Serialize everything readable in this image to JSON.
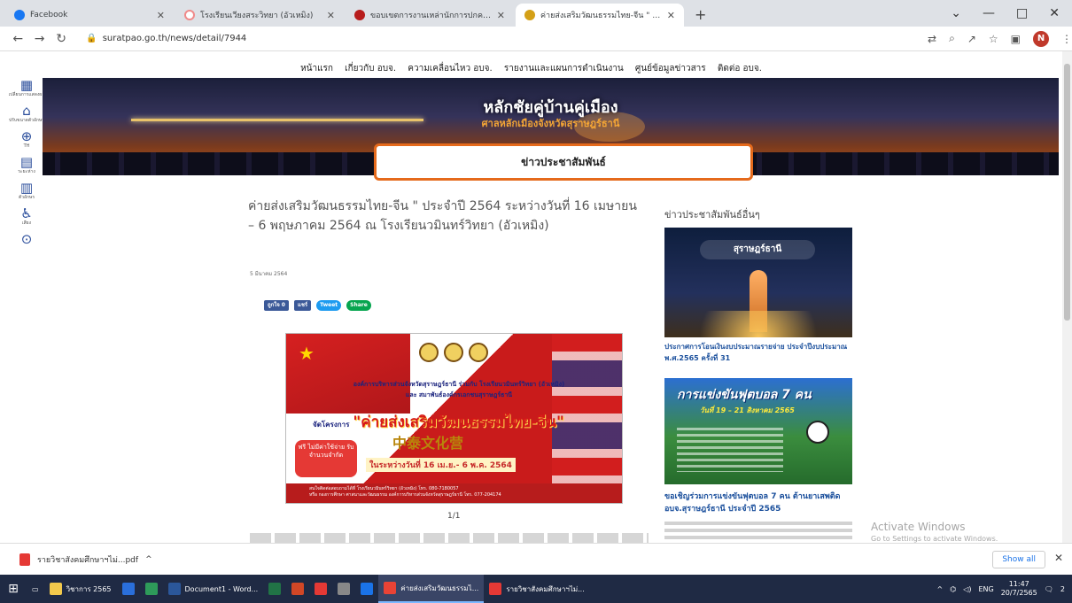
{
  "browser": {
    "tabs": [
      {
        "title": "Facebook",
        "color": "#1877f2",
        "active": false
      },
      {
        "title": "โรงเรียนเวียงสระวิทยา (อัวเหมิง)",
        "color": "#f08a8a",
        "active": false
      },
      {
        "title": "ขอบเขตการงานเหล่านักการปกครองส่วนท้องถิ่น",
        "color": "#b71c1c",
        "active": false
      },
      {
        "title": "ค่ายส่งเสริมวัฒนธรรมไทย-จีน \" ประจำ",
        "color": "#d4a017",
        "active": true
      }
    ],
    "new_tab": "+",
    "window_controls": {
      "minimize": "—",
      "maximize": "□",
      "close": "✕",
      "menu": "⌄"
    },
    "url": "suratpao.go.th/news/detail/7944",
    "profile_initial": "N"
  },
  "site": {
    "topnav": [
      "หน้าแรก",
      "เกี่ยวกับ อบจ.",
      "ความเคลื่อนไหว อบจ.",
      "รายงานและแผนการดำเนินงาน",
      "ศูนย์ข้อมูลข่าวสาร",
      "ติดต่อ อบจ."
    ],
    "side_tools": [
      {
        "glyph": "▦",
        "label": "เปลี่ยนการแสดงผล"
      },
      {
        "glyph": "⌂",
        "label": "ปรับขนาดตัวอักษร"
      },
      {
        "glyph": "⊕",
        "label": "TH"
      },
      {
        "glyph": "▤",
        "label": "ระยะห่าง"
      },
      {
        "glyph": "▥",
        "label": "ตัวอักษร"
      },
      {
        "glyph": "♿",
        "label": "เสียง"
      },
      {
        "glyph": "⊙",
        "label": ""
      }
    ],
    "banner_title": "หลักชัยคู่บ้านคู่เมือง",
    "banner_subtitle": "ศาลหลักเมืองจังหวัดสุราษฎร์ธานี",
    "section_title": "ข่าวประชาสัมพันธ์"
  },
  "article": {
    "title": "ค่ายส่งเสริมวัฒนธรรมไทย-จีน \" ประจำปี 2564 ระหว่างวันที่ 16 เมษายน – 6 พฤษภาคม 2564 ณ โรงเรียนวมินทร์วิทยา (อัวเหมิง)",
    "date": "5 มีนาคม 2564",
    "share": {
      "facebook": "ถูกใจ 0",
      "share": "แชร์",
      "tweet": "Tweet",
      "line": "Share"
    },
    "poster": {
      "line1": "องค์การบริหารส่วนจังหวัดสุราษฎร์ธานี ร่วมกับ โรงเรียนวมินทร์วิทยา (อัวเหมิง)",
      "line2": "และ สมาพันธ์องค์กรเอกชนสุราษฎร์ธานี",
      "headline_pre": "จัดโครงการ",
      "headline": "\"ค่ายส่งเสริมวัฒนธรรมไทย-จีน\"",
      "chinese": "中泰文化营",
      "free": "ฟรี ไม่มีค่าใช้จ่าย รับจำนวนจำกัด",
      "date": "ในระหว่างวันที่ 16 เม.ย.- 6 พ.ค. 2564",
      "footer1": "สนใจติดต่อสอบถามได้ที่ โรงเรียนวมินทร์วิทยา (อัวเหมิง) โทร. 080-7180057",
      "footer2": "หรือ กองการศึกษา ศาสนาและวัฒนธรรม องค์การบริหารส่วนจังหวัดสุราษฎร์ธานี โทร. 077-204174"
    },
    "pager": "1/1"
  },
  "sidebar": {
    "title": "ข่าวประชาสัมพันธ์อื่นๆ",
    "news": [
      {
        "image_text": "สุราษฎร์ธานี",
        "caption": "ประกาศการโอนเงินงบประมาณรายจ่าย ประจำปีงบประมาณ พ.ศ.2565 ครั้งที่ 31"
      },
      {
        "image_text": "การแข่งขันฟุตบอล 7 คน",
        "image_dates": "วันที่ 19 – 21 สิงหาคม 2565",
        "caption": "ขอเชิญร่วมการแข่งขันฟุตบอล 7 คน ต้านยาเสพติด อบจ.สุราษฎร์ธานี ประจำปี 2565"
      }
    ]
  },
  "watermark": {
    "line1": "Activate Windows",
    "line2": "Go to Settings to activate Windows."
  },
  "downloads": {
    "file": "รายวิชาสังคมศึกษาฯไม่...pdf",
    "chevron": "^",
    "show_all": "Show all",
    "close": "✕"
  },
  "taskbar": {
    "items": [
      {
        "label": "วิชาการ 2565",
        "color": "#f2c94c"
      },
      {
        "label": "",
        "color": "#2a6fdb"
      },
      {
        "label": "",
        "color": "#2e9b5a"
      },
      {
        "label": "Document1 - Word...",
        "color": "#2b579a"
      },
      {
        "label": "",
        "color": "#217346"
      },
      {
        "label": "",
        "color": "#d24726"
      },
      {
        "label": "",
        "color": "#e53935"
      },
      {
        "label": "",
        "color": "#888888"
      },
      {
        "label": "",
        "color": "#1a73e8"
      },
      {
        "label": "ค่ายส่งเสริมวัฒนธรรมไ...",
        "color": "#ea4335",
        "active": true
      },
      {
        "label": "รายวิชาสังคมศึกษาฯไม่...",
        "color": "#e53935"
      }
    ],
    "tray_lang": "ENG",
    "time": "11:47",
    "date": "20/7/2565",
    "notifications": "2"
  }
}
